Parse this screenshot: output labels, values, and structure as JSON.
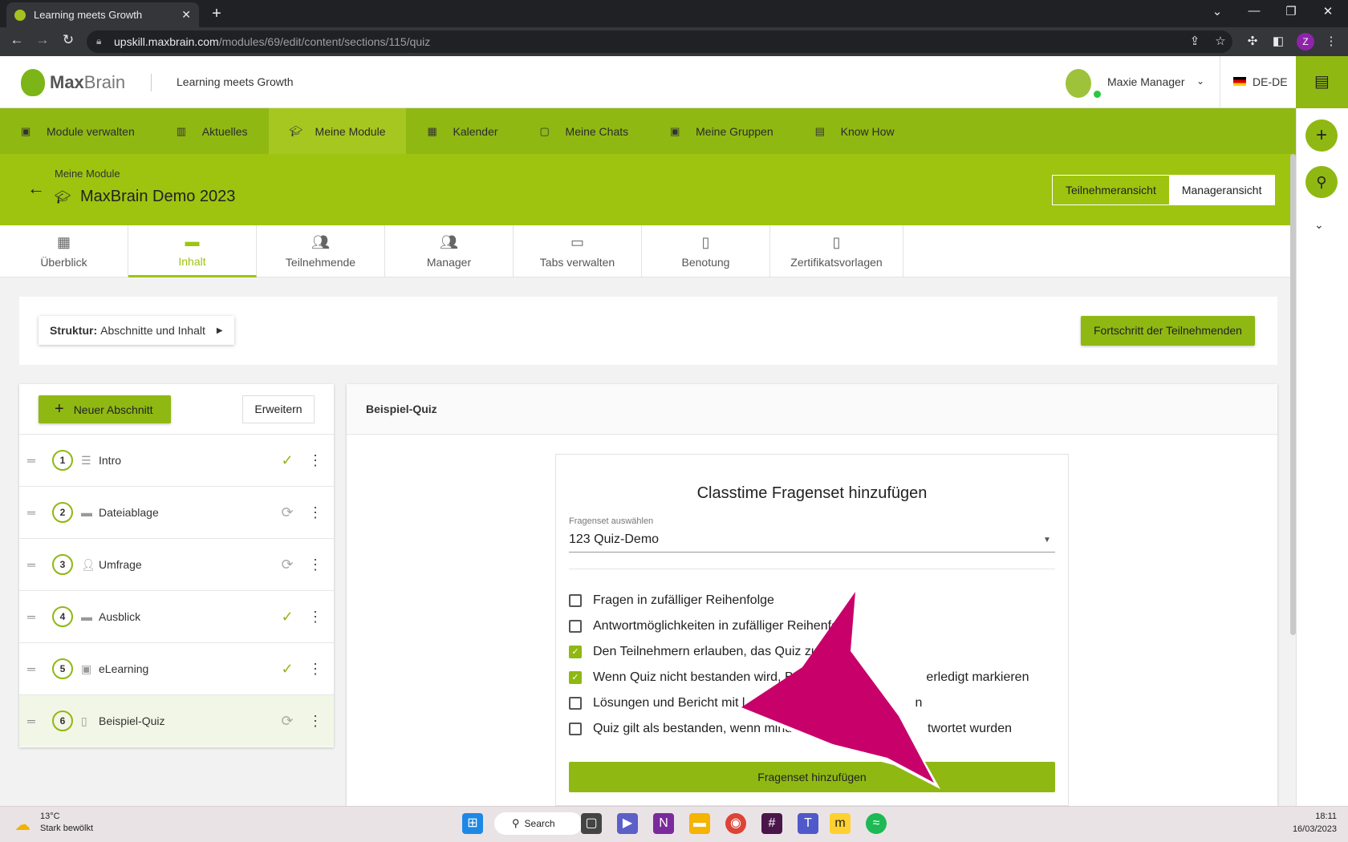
{
  "browser": {
    "tab_title": "Learning meets Growth",
    "url_host": "upskill.maxbrain.com",
    "url_path": "/modules/69/edit/content/sections/115/quiz",
    "profile_initial": "Z"
  },
  "header": {
    "logo_bold": "Max",
    "logo_light": "Brain",
    "tagline": "Learning meets Growth",
    "user_name": "Maxie Manager",
    "language": "DE-DE"
  },
  "nav": {
    "items": [
      {
        "label": "Module verwalten",
        "icon": "briefcase-icon"
      },
      {
        "label": "Aktuelles",
        "icon": "news-icon"
      },
      {
        "label": "Meine Module",
        "icon": "graduation-cap-icon"
      },
      {
        "label": "Kalender",
        "icon": "calendar-icon"
      },
      {
        "label": "Meine Chats",
        "icon": "chat-icon"
      },
      {
        "label": "Meine Gruppen",
        "icon": "group-icon"
      },
      {
        "label": "Know How",
        "icon": "book-icon"
      }
    ],
    "active": "Meine Module"
  },
  "module": {
    "breadcrumb": "Meine Module",
    "title": "MaxBrain Demo 2023",
    "view_participant": "Teilnehmeransicht",
    "view_manager": "Manageransicht"
  },
  "tabs": [
    {
      "label": "Überblick",
      "icon": "dashboard-icon"
    },
    {
      "label": "Inhalt",
      "icon": "folder-icon"
    },
    {
      "label": "Teilnehmende",
      "icon": "people-icon"
    },
    {
      "label": "Manager",
      "icon": "manager-icon"
    },
    {
      "label": "Tabs verwalten",
      "icon": "tabs-icon"
    },
    {
      "label": "Benotung",
      "icon": "grade-icon"
    },
    {
      "label": "Zertifikatsvorlagen",
      "icon": "certificate-icon"
    }
  ],
  "structure": {
    "label_bold": "Struktur:",
    "label_value": "Abschnitte und Inhalt",
    "progress_button": "Fortschritt der Teilnehmenden"
  },
  "sections": {
    "new_button": "Neuer Abschnitt",
    "expand_button": "Erweitern",
    "items": [
      {
        "num": "1",
        "label": "Intro",
        "status": "done"
      },
      {
        "num": "2",
        "label": "Dateiablage",
        "status": "sync"
      },
      {
        "num": "3",
        "label": "Umfrage",
        "status": "sync"
      },
      {
        "num": "4",
        "label": "Ausblick",
        "status": "done"
      },
      {
        "num": "5",
        "label": "eLearning",
        "status": "done"
      },
      {
        "num": "6",
        "label": "Beispiel-Quiz",
        "status": "sync"
      }
    ]
  },
  "quiz": {
    "title": "Beispiel-Quiz",
    "card_title": "Classtime Fragenset hinzufügen",
    "select_label": "Fragenset auswählen",
    "select_value": "123 Quiz-Demo",
    "options": [
      {
        "label": "Fragen in zufälliger Reihenfolge",
        "checked": false
      },
      {
        "label": "Antwortmöglichkeiten in zufälliger Reihenfolg",
        "checked": false
      },
      {
        "label": "Den Teilnehmern erlauben, das Quiz zu wied",
        "checked": true
      },
      {
        "label": "Wenn Quiz nicht bestanden wird, Bereich tr",
        "label_tail": "erledigt markieren",
        "checked": true
      },
      {
        "label": "Lösungen und Bericht mit l",
        "label_tail": "n",
        "checked": false
      },
      {
        "label": "Quiz gilt als bestanden, wenn mindes",
        "label_tail": "twortet wurden",
        "checked": false
      }
    ],
    "add_button": "Fragenset hinzufügen"
  },
  "taskbar": {
    "temperature": "13°C",
    "weather": "Stark bewölkt",
    "search": "Search",
    "time": "18:11",
    "date": "16/03/2023"
  }
}
